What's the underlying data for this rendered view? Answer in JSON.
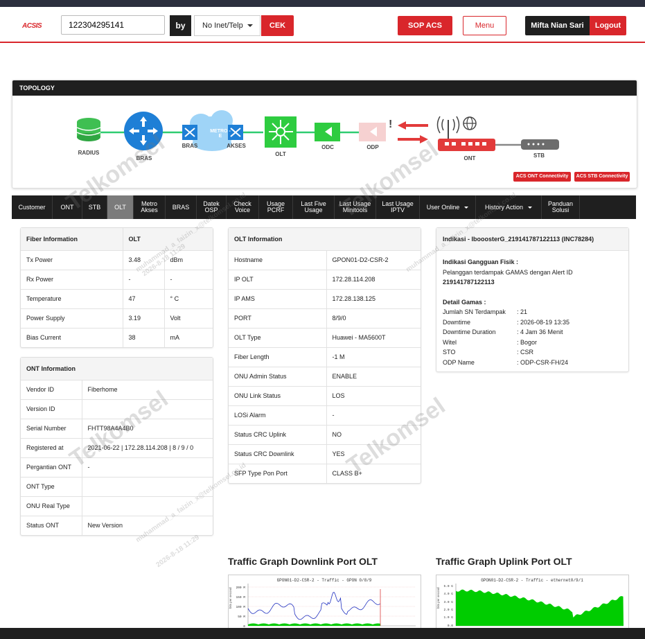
{
  "header": {
    "logo": "ACSIS",
    "search_value": "122304295141",
    "by_label": "by",
    "filter_selected": "No Inet/Telp",
    "cek_label": "CEK",
    "sop_label": "SOP ACS",
    "menu_label": "Menu",
    "user_name": "Mifta Nian Sari",
    "logout_label": "Logout"
  },
  "topology": {
    "title": "TOPOLOGY",
    "nodes": {
      "radius": "RADIUS",
      "bras": "BRAS",
      "bras2": "BRAS",
      "metro": "METRO - E",
      "akses": "AKSES",
      "olt": "OLT",
      "odc": "ODC",
      "odp": "ODP",
      "ont": "ONT",
      "stb": "STB"
    },
    "alert_mark": "!",
    "acs_ont_btn": "ACS ONT Connectivity",
    "acs_stb_btn": "ACS STB Connectivity"
  },
  "tabs": [
    {
      "label": "Customer"
    },
    {
      "label": "ONT"
    },
    {
      "label": "STB"
    },
    {
      "label": "OLT"
    },
    {
      "label": "Metro Akses"
    },
    {
      "label": "BRAS"
    },
    {
      "label": "Datek OSP"
    },
    {
      "label": "Check Voice"
    },
    {
      "label": "Usage PCRF"
    },
    {
      "label": "Last Five Usage"
    },
    {
      "label": "Last Usage Minitools"
    },
    {
      "label": "Last Usage IPTV"
    },
    {
      "label": "User Online"
    },
    {
      "label": "History Action"
    },
    {
      "label": "Panduan Solusi"
    }
  ],
  "fiber": {
    "header": [
      "Fiber Information",
      "OLT"
    ],
    "rows": [
      [
        "Tx Power",
        "3.48",
        "dBm"
      ],
      [
        "Rx Power",
        "-",
        "-"
      ],
      [
        "Temperature",
        "47",
        "° C"
      ],
      [
        "Power Supply",
        "3.19",
        "Volt"
      ],
      [
        "Bias Current",
        "38",
        "mA"
      ]
    ]
  },
  "ont": {
    "header": "ONT Information",
    "rows": [
      [
        "Vendor ID",
        "Fiberhome"
      ],
      [
        "Version ID",
        ""
      ],
      [
        "Serial Number",
        "FHTT98A4A4B0"
      ],
      [
        "Registered at",
        "2021-06-22 | 172.28.114.208 | 8 / 9 / 0"
      ],
      [
        "Pergantian ONT",
        "-"
      ],
      [
        "ONT Type",
        ""
      ],
      [
        "ONU Real Type",
        ""
      ],
      [
        "Status ONT",
        "New Version"
      ]
    ]
  },
  "olt": {
    "header": "OLT Information",
    "rows": [
      [
        "Hostname",
        "GPON01-D2-CSR-2"
      ],
      [
        "IP OLT",
        "172.28.114.208"
      ],
      [
        "IP AMS",
        "172.28.138.125"
      ],
      [
        "PORT",
        "8/9/0"
      ],
      [
        "OLT Type",
        "Huawei - MA5600T"
      ],
      [
        "Fiber Length",
        "-1 M"
      ],
      [
        "ONU Admin Status",
        "ENABLE"
      ],
      [
        "ONU Link Status",
        "LOS"
      ],
      [
        "LOSi Alarm",
        "-"
      ],
      [
        "Status CRC Uplink",
        "NO"
      ],
      [
        "Status CRC Downlink",
        "YES"
      ],
      [
        "SFP Type Pon Port",
        "CLASS B+"
      ]
    ]
  },
  "indikasi": {
    "title": "Indikasi - IbooosterG_219141787122113 (INC78284)",
    "gangguan_label": "Indikasi Gangguan Fisik :",
    "gangguan_text": "Pelanggan terdampak GAMAS dengan Alert ID",
    "alert_id": "219141787122113",
    "detail_label": "Detail Gamas :",
    "details": [
      [
        "Jumlah SN Terdampak",
        ": 21"
      ],
      [
        "Downtime",
        ": 2026-08-19 13:35"
      ],
      [
        "Downtime Duration",
        ": 4 Jam 36 Menit"
      ],
      [
        "Witel",
        ": Bogor"
      ],
      [
        "STO",
        ": CSR"
      ],
      [
        "ODP Name",
        ": ODP-CSR-FH/24"
      ]
    ]
  },
  "graphs": {
    "downlink_title": "Traffic Graph Downlink Port OLT",
    "uplink_title": "Traffic Graph Uplink Port OLT",
    "downlink_caption": "GPON01-D2-CSR-2 - Traffic - GPON 0/8/9",
    "uplink_caption": "GPON01-D2-CSR-2 - Traffic - ethernet0/9/1",
    "axis_label": "bits per second",
    "down_ticks": [
      "200 M",
      "150 M",
      "100 M",
      "50 M",
      "0"
    ],
    "up_ticks": [
      "5.0 G",
      "4.0 G",
      "3.0 G",
      "2.0 G",
      "1.0 G",
      "0.0"
    ],
    "down_in_color": "#2030c0",
    "down_out_color": "#00cc00",
    "up_in_color": "#00cc00"
  },
  "watermark": {
    "brand": "Telkomsel",
    "user": "muhammad_a_faizin_x@telkomsel.co.id",
    "stamp": "2026-8-18 11:29"
  }
}
